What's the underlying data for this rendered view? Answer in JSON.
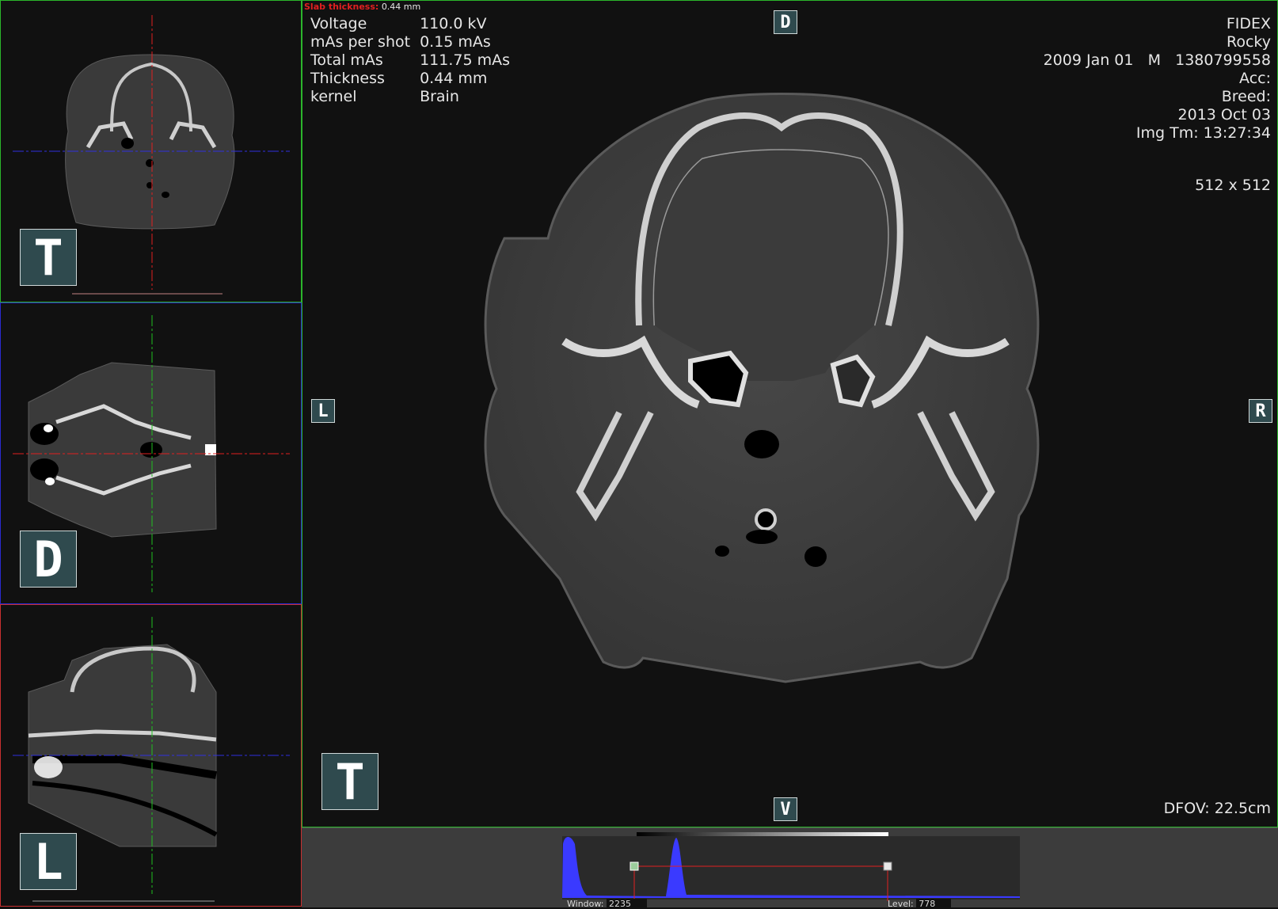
{
  "orientation": {
    "axial": "T",
    "dorsal": "D",
    "lateral": "L",
    "main": "T",
    "main_top": "D",
    "main_left": "L",
    "main_right": "R",
    "main_bottom": "V"
  },
  "slab": {
    "label": "Slab thickness:",
    "value": "0.44 mm"
  },
  "scan_info": [
    {
      "key": "Voltage",
      "value": "110.0 kV"
    },
    {
      "key": "mAs per shot",
      "value": "0.15 mAs"
    },
    {
      "key": "Total mAs",
      "value": "111.75 mAs"
    },
    {
      "key": "Thickness",
      "value": "0.44 mm"
    },
    {
      "key": "kernel",
      "value": "Brain"
    }
  ],
  "patient": {
    "institution": "FIDEX",
    "name": "Rocky",
    "line3": "2009 Jan 01   M   1380799558",
    "acc": "Acc:",
    "breed": "Breed:",
    "study_date": "2013 Oct 03",
    "img_time": "Img Tm: 13:27:34"
  },
  "matrix": "512 x 512",
  "dfov": "DFOV: 22.5cm",
  "window_level": {
    "window_label": "Window:",
    "window_value": "2235",
    "level_label": "Level:",
    "level_value": "778"
  },
  "colors": {
    "axial_border": "#2bb52b",
    "dorsal_border": "#2a2ad0",
    "lateral_border": "#c83030",
    "histogram": "#3a3aff",
    "crosshair_red": "#e02020",
    "crosshair_green": "#20c020",
    "crosshair_blue": "#3030e0"
  }
}
